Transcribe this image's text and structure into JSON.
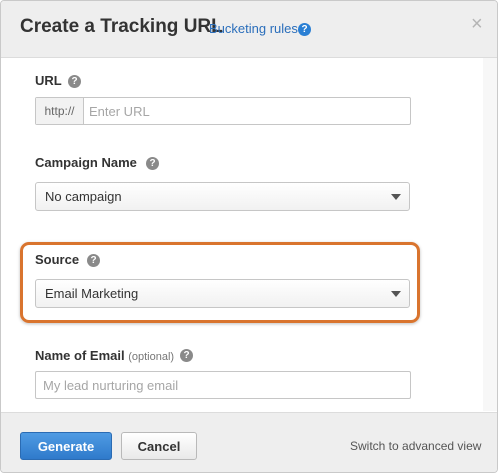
{
  "dialog": {
    "title": "Create a Tracking URL",
    "bucketing_link": "Bucketing rules",
    "help_glyph": "?",
    "close_glyph": "×"
  },
  "fields": {
    "url": {
      "label": "URL",
      "prefix": "http://",
      "placeholder": "Enter URL",
      "value": ""
    },
    "campaign": {
      "label": "Campaign Name",
      "selected": "No campaign"
    },
    "source": {
      "label": "Source",
      "selected": "Email Marketing"
    },
    "email_name": {
      "label": "Name of Email",
      "optional": "(optional)",
      "placeholder": "My lead nurturing email",
      "value": ""
    }
  },
  "footer": {
    "generate": "Generate",
    "cancel": "Cancel",
    "advanced": "Switch to advanced view"
  },
  "colors": {
    "primary": "#2f7acb",
    "link": "#2a6ebb",
    "highlight": "#d9742e"
  }
}
